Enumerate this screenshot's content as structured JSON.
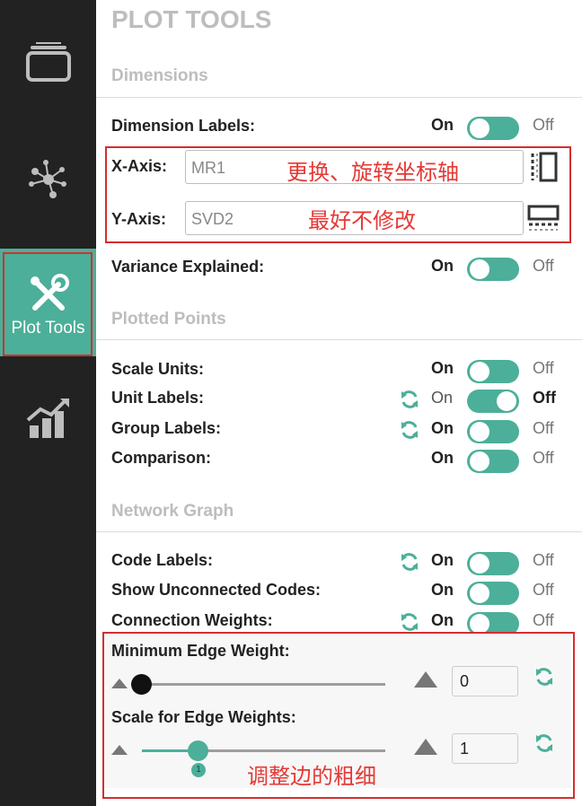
{
  "nav": {
    "items": [
      {
        "name": "layers"
      },
      {
        "name": "network"
      },
      {
        "name": "plot-tools",
        "label": "Plot Tools"
      },
      {
        "name": "chart"
      }
    ]
  },
  "panel": {
    "title": "PLOT TOOLS",
    "sections": {
      "dimensions": "Dimensions",
      "plotted_points": "Plotted Points",
      "network_graph": "Network Graph"
    },
    "dimension_labels": {
      "label": "Dimension Labels:",
      "on": "On",
      "off": "Off"
    },
    "x_axis": {
      "label": "X-Axis:",
      "value": "MR1"
    },
    "y_axis": {
      "label": "Y-Axis:",
      "value": "SVD2"
    },
    "variance_explained": {
      "label": "Variance Explained:",
      "on": "On",
      "off": "Off"
    },
    "scale_units": {
      "label": "Scale Units:",
      "on": "On",
      "off": "Off"
    },
    "unit_labels": {
      "label": "Unit Labels:",
      "on": "On",
      "off": "Off"
    },
    "group_labels": {
      "label": "Group Labels:",
      "on": "On",
      "off": "Off"
    },
    "comparison": {
      "label": "Comparison:",
      "on": "On",
      "off": "Off"
    },
    "code_labels": {
      "label": "Code Labels:",
      "on": "On",
      "off": "Off"
    },
    "show_unconnected": {
      "label": "Show Unconnected Codes:",
      "on": "On",
      "off": "Off"
    },
    "connection_weights": {
      "label": "Connection Weights:",
      "on": "On",
      "off": "Off"
    },
    "min_edge_weight": {
      "label": "Minimum Edge Weight:",
      "value": "0"
    },
    "scale_edge_weights": {
      "label": "Scale for Edge Weights:",
      "value": "1",
      "badge": "1"
    }
  },
  "annotations": {
    "swap_rotate": "更换、旋转坐标轴",
    "best_not_modify": "最好不修改",
    "adjust_edges": "调整边的粗细"
  },
  "colors": {
    "accent": "#4caf99",
    "annotation": "#d32f2f",
    "nav_bg": "#222222"
  }
}
